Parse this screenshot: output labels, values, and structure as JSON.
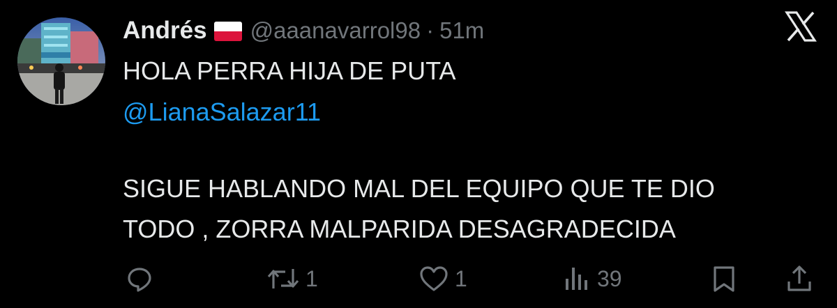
{
  "tweet": {
    "author": {
      "display_name": "Andrés",
      "flag": "flag-poland-icon",
      "handle": "@aaanavarrol98",
      "separator": "·",
      "time": "51m"
    },
    "lines": [
      "HOLA PERRA HIJA DE PUTA",
      "SIGUE HABLANDO MAL DEL EQUIPO QUE TE DIO",
      "TODO , ZORRA MALPARIDA DESAGRADECIDA"
    ],
    "mention": "@LianaSalazar11",
    "actions": {
      "reply_icon": "reply-icon",
      "retweet_count": "1",
      "like_count": "1",
      "views_count": "39",
      "bookmark_icon": "bookmark-icon",
      "share_icon": "share-icon"
    }
  },
  "colors": {
    "background": "#000000",
    "text": "#e7e9ea",
    "muted": "#71767b",
    "link": "#1d9bf0"
  }
}
